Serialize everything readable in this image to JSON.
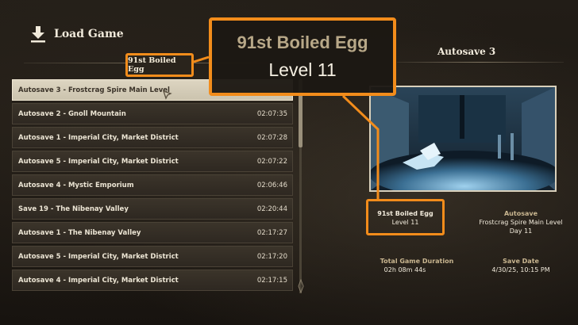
{
  "header": {
    "title": "Load Game",
    "icon": "download-icon"
  },
  "character_tag": "91st Boiled Egg",
  "saves": [
    {
      "name": "Autosave 3 - Frostcrag Spire Main Level",
      "time": "",
      "selected": true
    },
    {
      "name": "Autosave 2 - Gnoll Mountain",
      "time": "02:07:35"
    },
    {
      "name": "Autosave 1 - Imperial City, Market District",
      "time": "02:07:28"
    },
    {
      "name": "Autosave 5 - Imperial City, Market District",
      "time": "02:07:22"
    },
    {
      "name": "Autosave 4 - Mystic Emporium",
      "time": "02:06:46"
    },
    {
      "name": "Save 19 - The Nibenay Valley",
      "time": "02:20:44"
    },
    {
      "name": "Autosave 1 - The Nibenay Valley",
      "time": "02:17:27"
    },
    {
      "name": "Autosave 5 - Imperial City, Market District",
      "time": "02:17:20"
    },
    {
      "name": "Autosave 4 - Imperial City, Market District",
      "time": "02:17:15"
    }
  ],
  "details": {
    "title": "Autosave 3",
    "character_name": "91st Boiled Egg",
    "character_level": "Level 11",
    "save_type": "Autosave",
    "location": "Frostcrag Spire Main Level",
    "day": "Day 11",
    "duration_label": "Total Game Duration",
    "duration_value": "02h 08m 44s",
    "date_label": "Save Date",
    "date_value": "4/30/25, 10:15 PM"
  },
  "callout": {
    "name": "91st Boiled Egg",
    "level": "Level 11"
  },
  "colors": {
    "highlight": "#f28c1b",
    "selected_row": "#d6cebb",
    "row": "#352f27"
  }
}
